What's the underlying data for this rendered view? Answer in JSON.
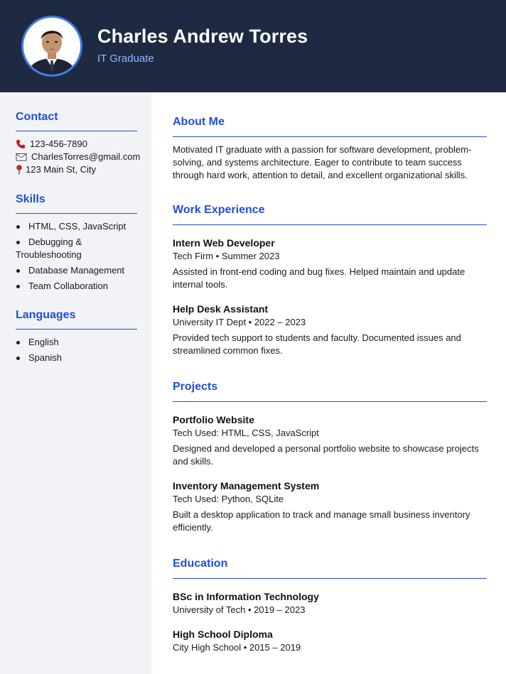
{
  "header": {
    "name": "Charles Andrew Torres",
    "role": "IT Graduate"
  },
  "colors": {
    "header_bg": "#1e2a41",
    "accent": "#1f4fd6",
    "role_text": "#8fb6ff",
    "sidebar_bg": "#f1f3f6"
  },
  "sidebar": {
    "contact": {
      "heading": "Contact",
      "phone": "123-456-7890",
      "email": "CharlesTorres@gmail.com",
      "address": "123 Main St, City",
      "icons": [
        "phone-icon",
        "email-icon",
        "location-pin-icon"
      ]
    },
    "skills": {
      "heading": "Skills",
      "items": [
        "HTML, CSS, JavaScript",
        "Debugging & Troubleshooting",
        "Database Management",
        "Team Collaboration"
      ]
    },
    "languages": {
      "heading": "Languages",
      "items": [
        "English",
        "Spanish"
      ]
    }
  },
  "main": {
    "about": {
      "heading": "About Me",
      "text": "Motivated IT graduate with a passion for software development, problem-solving, and systems architecture. Eager to contribute to team success through hard work, attention to detail, and excellent organizational skills."
    },
    "experience": {
      "heading": "Work Experience",
      "items": [
        {
          "title": "Intern Web Developer",
          "meta": "Tech Firm • Summer 2023",
          "description": "Assisted in front-end coding and bug fixes. Helped maintain and update internal tools."
        },
        {
          "title": "Help Desk Assistant",
          "meta": "University IT Dept • 2022 – 2023",
          "description": "Provided tech support to students and faculty. Documented issues and streamlined common fixes."
        }
      ]
    },
    "projects": {
      "heading": "Projects",
      "items": [
        {
          "title": "Portfolio Website",
          "meta": "Tech Used: HTML, CSS, JavaScript",
          "description": "Designed and developed a personal portfolio website to showcase projects and skills."
        },
        {
          "title": "Inventory Management System",
          "meta": "Tech Used: Python, SQLite",
          "description": "Built a desktop application to track and manage small business inventory efficiently."
        }
      ]
    },
    "education": {
      "heading": "Education",
      "items": [
        {
          "title": "BSc in Information Technology",
          "meta": "University of Tech • 2019 – 2023"
        },
        {
          "title": "High School Diploma",
          "meta": "City High School • 2015 – 2019"
        }
      ]
    }
  }
}
